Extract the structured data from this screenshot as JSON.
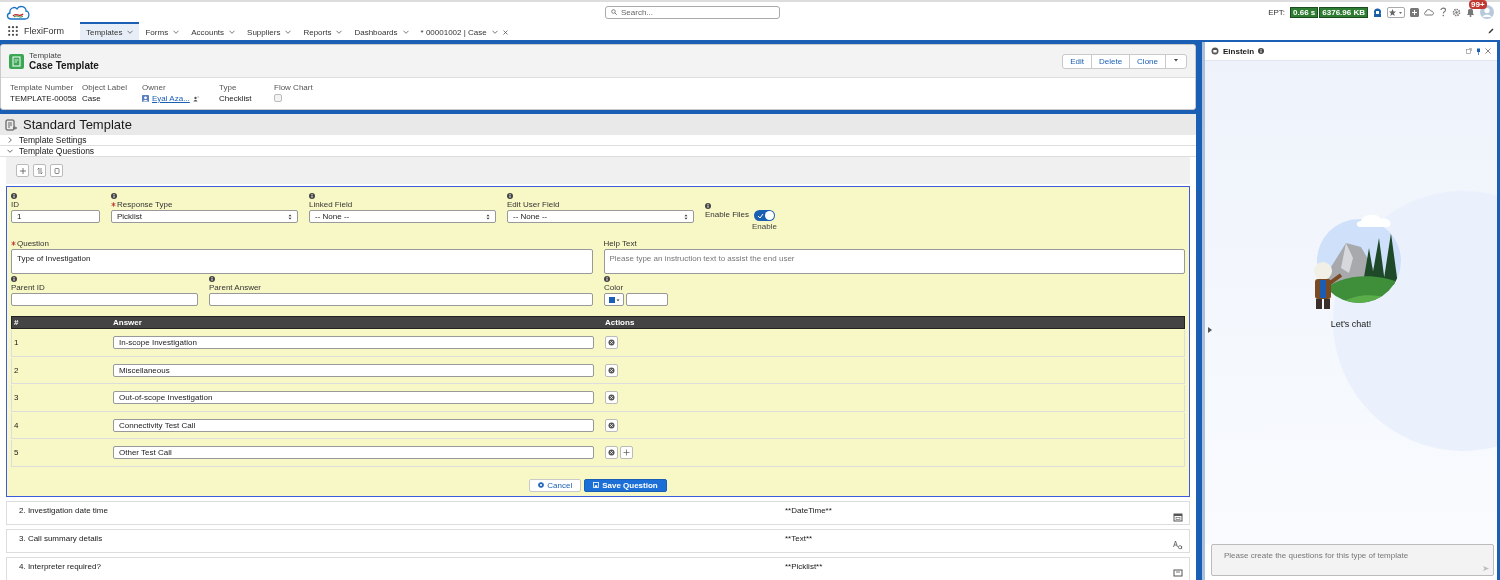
{
  "app": {
    "name": "FlexiForm"
  },
  "search": {
    "placeholder": "Search..."
  },
  "header": {
    "ept_label": "EPT:",
    "ept_time": "0.66 s",
    "ept_size": "6376.96 KB",
    "notification_count": "99+"
  },
  "nav_tabs": [
    {
      "label": "Templates",
      "selected": true,
      "kind": "menu"
    },
    {
      "label": "Forms",
      "selected": false,
      "kind": "menu"
    },
    {
      "label": "Accounts",
      "selected": false,
      "kind": "menu"
    },
    {
      "label": "Suppliers",
      "selected": false,
      "kind": "menu"
    },
    {
      "label": "Reports",
      "selected": false,
      "kind": "menu"
    },
    {
      "label": "Dashboards",
      "selected": false,
      "kind": "menu"
    },
    {
      "label": "* 00001002 | Case",
      "selected": false,
      "kind": "record"
    }
  ],
  "record": {
    "type_label": "Template",
    "title": "Case Template",
    "actions": [
      "Edit",
      "Delete",
      "Clone"
    ],
    "fields": [
      {
        "label": "Template Number",
        "value": "TEMPLATE-00058",
        "kind": "text"
      },
      {
        "label": "Object Label",
        "value": "Case",
        "kind": "text"
      },
      {
        "label": "Owner",
        "value": "Eyal Aza...",
        "kind": "user"
      },
      {
        "label": "Type",
        "value": "Checklist",
        "kind": "text"
      },
      {
        "label": "Flow Chart",
        "checked": false,
        "kind": "checkbox"
      }
    ]
  },
  "section": {
    "title": "Standard Template",
    "accordions": [
      {
        "label": "Template Settings",
        "expanded": false
      },
      {
        "label": "Template Questions",
        "expanded": true
      }
    ]
  },
  "editor": {
    "id": {
      "label": "ID",
      "value": "1"
    },
    "response_type": {
      "label": "Response Type",
      "value": "Picklist",
      "required": true
    },
    "linked_field": {
      "label": "Linked Field",
      "value": "-- None --"
    },
    "edit_user_field": {
      "label": "Edit User Field",
      "value": "-- None --"
    },
    "enable_files": {
      "label": "Enable Files",
      "on": true,
      "state_label": "Enable"
    },
    "question": {
      "label": "Question",
      "value": "Type of Investigation",
      "required": true
    },
    "help_text": {
      "label": "Help Text",
      "placeholder": "Please type an instruction text to assist the end user"
    },
    "parent_id": {
      "label": "Parent ID"
    },
    "parent_answer": {
      "label": "Parent Answer"
    },
    "color": {
      "label": "Color"
    },
    "answers": {
      "columns": [
        "#",
        "Answer",
        "Actions"
      ],
      "rows": [
        {
          "number": "1",
          "answer": "In-scope Investigation"
        },
        {
          "number": "2",
          "answer": "Miscellaneous"
        },
        {
          "number": "3",
          "answer": "Out-of-scope Investigation"
        },
        {
          "number": "4",
          "answer": "Connectivity Test Call"
        },
        {
          "number": "5",
          "answer": "Other Test Call"
        }
      ]
    },
    "buttons": [
      {
        "label": "Cancel",
        "kind": "neutral"
      },
      {
        "label": "Save Question",
        "kind": "brand"
      }
    ]
  },
  "questions": [
    {
      "title": "2. Investigation date time",
      "type": "**DateTime**",
      "kind": "datetime"
    },
    {
      "title": "3. Call summary details",
      "type": "**Text**",
      "kind": "text"
    },
    {
      "title": "4. Interpreter required?",
      "type": "**Picklist**",
      "kind": "picklist"
    }
  ],
  "einstein": {
    "title": "Einstein",
    "greeting": "Let's chat!",
    "placeholder": "Please create the questions for this type of template"
  }
}
